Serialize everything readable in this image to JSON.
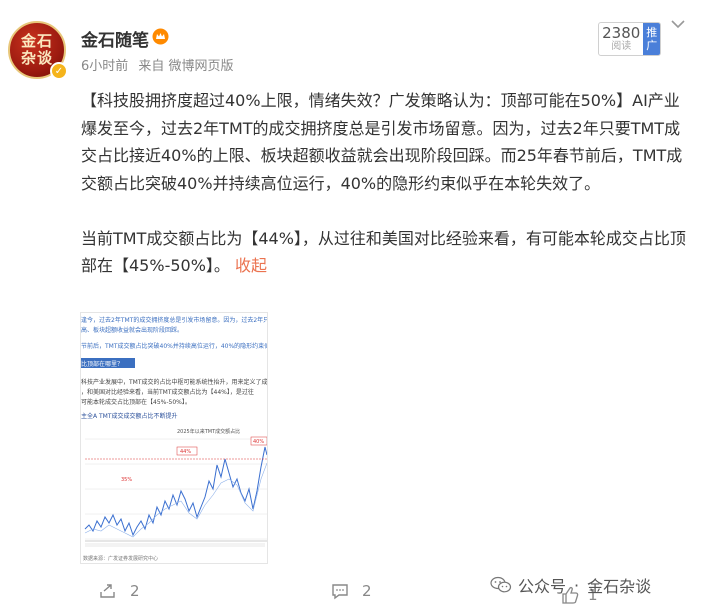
{
  "account": {
    "avatar_text": "金石杂谈",
    "name": "金石随笔",
    "time": "6小时前",
    "source": "来自 微博网页版"
  },
  "rank": {
    "number": "2380",
    "label": "阅读",
    "action": "推广"
  },
  "post": {
    "paragraph1": "【科技股拥挤度超过40%上限，情绪失效？广发策略认为：顶部可能在50%】AI产业爆发至今，过去2年TMT的成交拥挤度总是引发市场留意。因为，过去2年只要TMT成交占比接近40%的上限、板块超额收益就会出现阶段回踩。而25年春节前后，TMT成交额占比突破40%并持续高位运行，40%的隐形约束似乎在本轮失效了。",
    "paragraph2": "当前TMT成交额占比为【44%】，从过往和美国对比经验来看，有可能本轮成交占比顶部在【45%-50%】。",
    "collapse_label": "收起"
  },
  "thumbnail": {
    "lines": [
      "逢今，过去2年TMT的成交拥挤度总是引发市场留意。因为，过去2年只要TMT",
      "高、板块超额收益就会出现阶段回踩。",
      "节前后，TMT成交额占比突破40%并持续高位运行，40%的隐形约束似乎在本轮失",
      "比顶部在哪里？",
      "科技产业发展中，TMT成交的占比中枢可能系统性抬升，用来定义了成",
      "，和美国对比经验来看，当前TMT成交额占比为【44%】，是过往",
      "可能本轮成交占比顶部在【45%-50%】。",
      "主全A TMT成交成交额占比不断提升"
    ],
    "notes": [
      "2025年以来TMT成交额占比",
      "44%",
      "40%",
      "35%"
    ],
    "footer": "数据来源：广发证券发展研究中心"
  },
  "toolbar": {
    "forward_count": "2",
    "comment_count": "2",
    "like_count": "1"
  },
  "watermark": {
    "prefix": "公众号",
    "separator": "·",
    "name": "金石杂谈"
  }
}
